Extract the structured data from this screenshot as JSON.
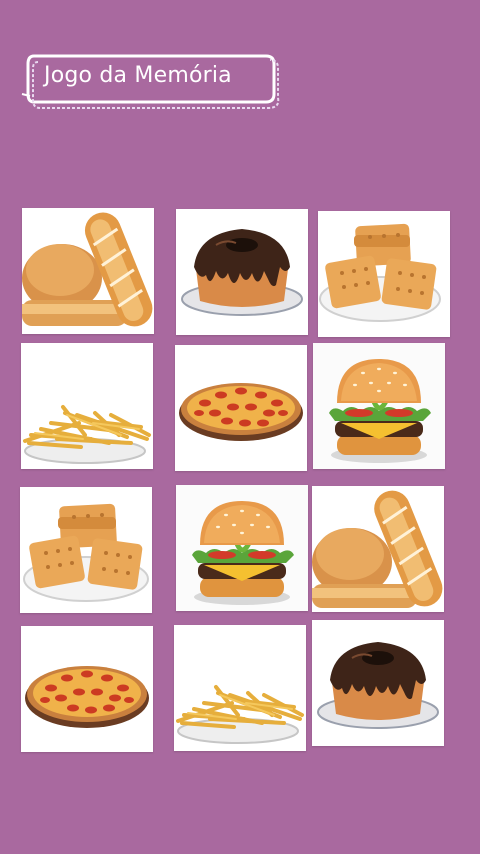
{
  "title": "Jogo da Memória",
  "colors": {
    "background": "#a9699f",
    "card": "#ffffff"
  },
  "cards": [
    {
      "row": 1,
      "col": 1,
      "food": "bread"
    },
    {
      "row": 1,
      "col": 2,
      "food": "bundt-cake"
    },
    {
      "row": 1,
      "col": 3,
      "food": "crackers"
    },
    {
      "row": 2,
      "col": 1,
      "food": "fries"
    },
    {
      "row": 2,
      "col": 2,
      "food": "pizza"
    },
    {
      "row": 2,
      "col": 3,
      "food": "burger"
    },
    {
      "row": 3,
      "col": 1,
      "food": "crackers"
    },
    {
      "row": 3,
      "col": 2,
      "food": "burger"
    },
    {
      "row": 3,
      "col": 3,
      "food": "bread"
    },
    {
      "row": 4,
      "col": 1,
      "food": "pizza"
    },
    {
      "row": 4,
      "col": 2,
      "food": "fries"
    },
    {
      "row": 4,
      "col": 3,
      "food": "bundt-cake"
    }
  ]
}
